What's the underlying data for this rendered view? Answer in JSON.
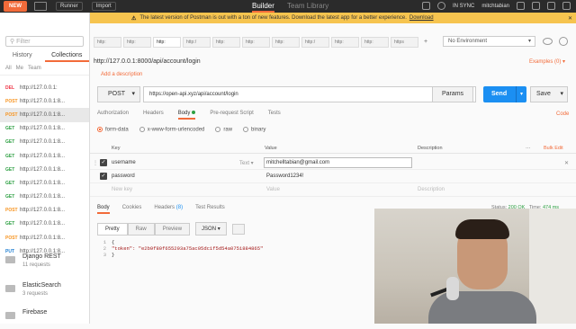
{
  "topbar": {
    "new_label": "NEW",
    "runner_label": "Runner",
    "import_label": "Import",
    "tab_builder": "Builder",
    "tab_team": "Team Library",
    "sync_label": "IN SYNC",
    "user": "mitchtabian"
  },
  "banner": {
    "message": "The latest version of Postman is out with a ton of new features. Download the latest app for a better experience.",
    "link": "Download",
    "close": "✕"
  },
  "sidebar": {
    "filter_placeholder": "Filter",
    "tabs": [
      "History",
      "Collections"
    ],
    "toolbar": [
      "All",
      "Me",
      "Team"
    ],
    "requests": [
      {
        "verb": "DEL",
        "url": "http://127.0.0.1:"
      },
      {
        "verb": "POST",
        "url": "http://127.0.0.1:8..."
      },
      {
        "verb": "POST",
        "url": "http://127.0.0.1:8..."
      },
      {
        "verb": "GET",
        "url": "http://127.0.0.1:8..."
      },
      {
        "verb": "GET",
        "url": "http://127.0.0.1:8..."
      },
      {
        "verb": "GET",
        "url": "http://127.0.0.1:8..."
      },
      {
        "verb": "GET",
        "url": "http://127.0.0.1:8..."
      },
      {
        "verb": "GET",
        "url": "http://127.0.0.1:8..."
      },
      {
        "verb": "GET",
        "url": "http://127.0.0.1:8..."
      },
      {
        "verb": "POST",
        "url": "http://127.0.0.1:8..."
      },
      {
        "verb": "GET",
        "url": "http://127.0.0.1:8..."
      },
      {
        "verb": "POST",
        "url": "http://127.0.0.1:8..."
      },
      {
        "verb": "PUT",
        "url": "http://127.0.0.1:8..."
      }
    ],
    "collections": [
      {
        "name": "Django REST",
        "count": "11 requests"
      },
      {
        "name": "ElasticSearch",
        "count": "3 requests"
      },
      {
        "name": "Firebase",
        "count": ""
      }
    ]
  },
  "tabs": [
    "http:",
    "http:",
    "http:",
    "http:/",
    "http:",
    "http:",
    "http:",
    "http:/",
    "http:",
    "http:",
    "https"
  ],
  "environment": "No Environment",
  "request": {
    "title": "http://127.0.0.1:8000/api/account/login",
    "add_description": "Add a description",
    "examples": "Examples (0) ▾",
    "method": "POST",
    "url": "https://open-api.xyz/api/account/login",
    "params_label": "Params",
    "send_label": "Send",
    "save_label": "Save",
    "subtabs": [
      "Authorization",
      "Headers",
      "Body",
      "Pre-request Script",
      "Tests"
    ],
    "code_label": "Code",
    "body_types": [
      "form-data",
      "x-www-form-urlencoded",
      "raw",
      "binary"
    ]
  },
  "kv": {
    "headers": {
      "key": "Key",
      "value": "Value",
      "description": "Description",
      "more": "···",
      "bulk": "Bulk Edit"
    },
    "rows": [
      {
        "key": "username",
        "type": "Text ▾",
        "value": "mitchelltabian@gmail.com"
      },
      {
        "key": "password",
        "type": "",
        "value": "Password1234!"
      }
    ],
    "new_key": "New key",
    "new_value": "Value",
    "new_desc": "Description"
  },
  "response": {
    "tabs": [
      "Body",
      "Cookies",
      "Headers",
      "Test Results"
    ],
    "headers_count": "(8)",
    "status_label": "Status:",
    "status_value": "200 OK",
    "time_label": "Time:",
    "time_value": "474 ms",
    "formats": [
      "Pretty",
      "Raw",
      "Preview"
    ],
    "json_label": "JSON ▾",
    "code_lines": [
      {
        "n": "1",
        "text": "{"
      },
      {
        "n": "2",
        "text": "    \"token\": \"e2b9f80f655293a75ac05dc1f5d54a0751884865\""
      },
      {
        "n": "3",
        "text": "}"
      }
    ]
  }
}
